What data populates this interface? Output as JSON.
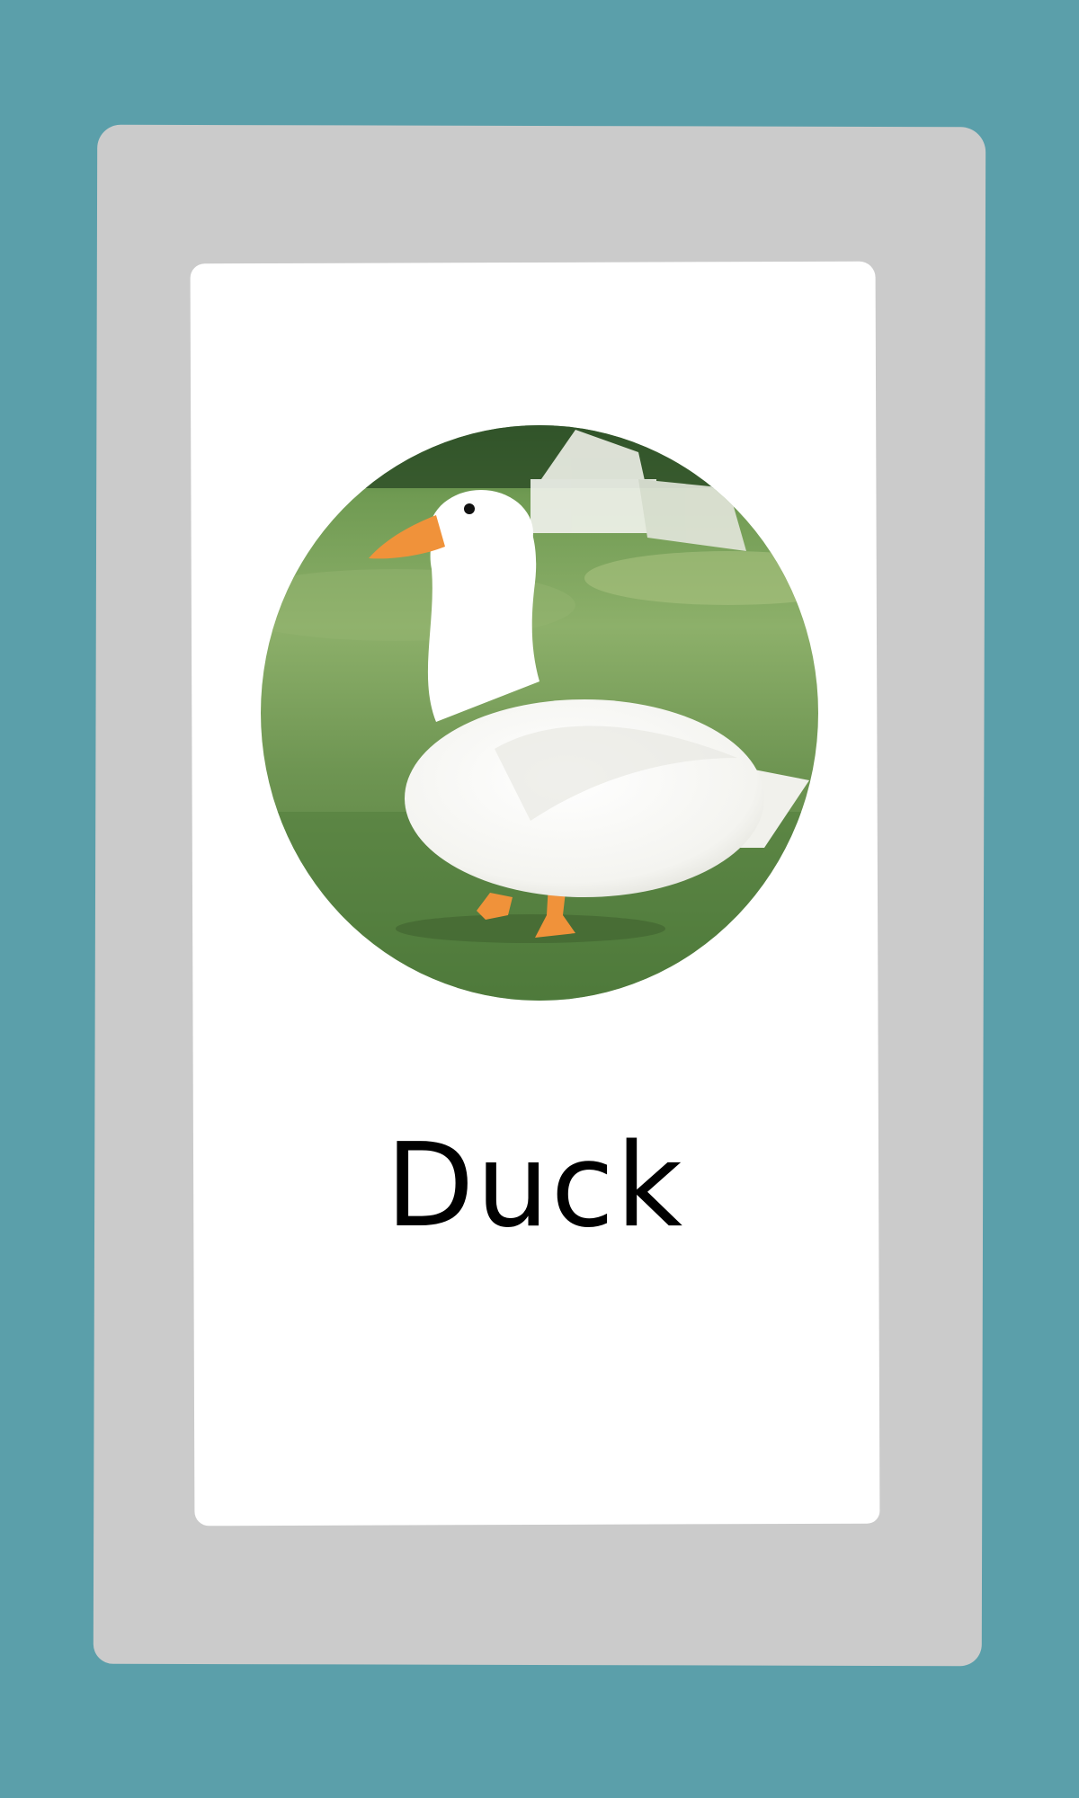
{
  "card": {
    "label": "Duck",
    "image_subject": "white-duck-on-grass"
  },
  "colors": {
    "background": "#5b9faa",
    "frame": "#cbcbcb",
    "card": "#ffffff",
    "label_text": "#000000",
    "grass": "#6f9a52",
    "duck_body": "#ffffff",
    "beak_and_feet": "#f0923a"
  }
}
